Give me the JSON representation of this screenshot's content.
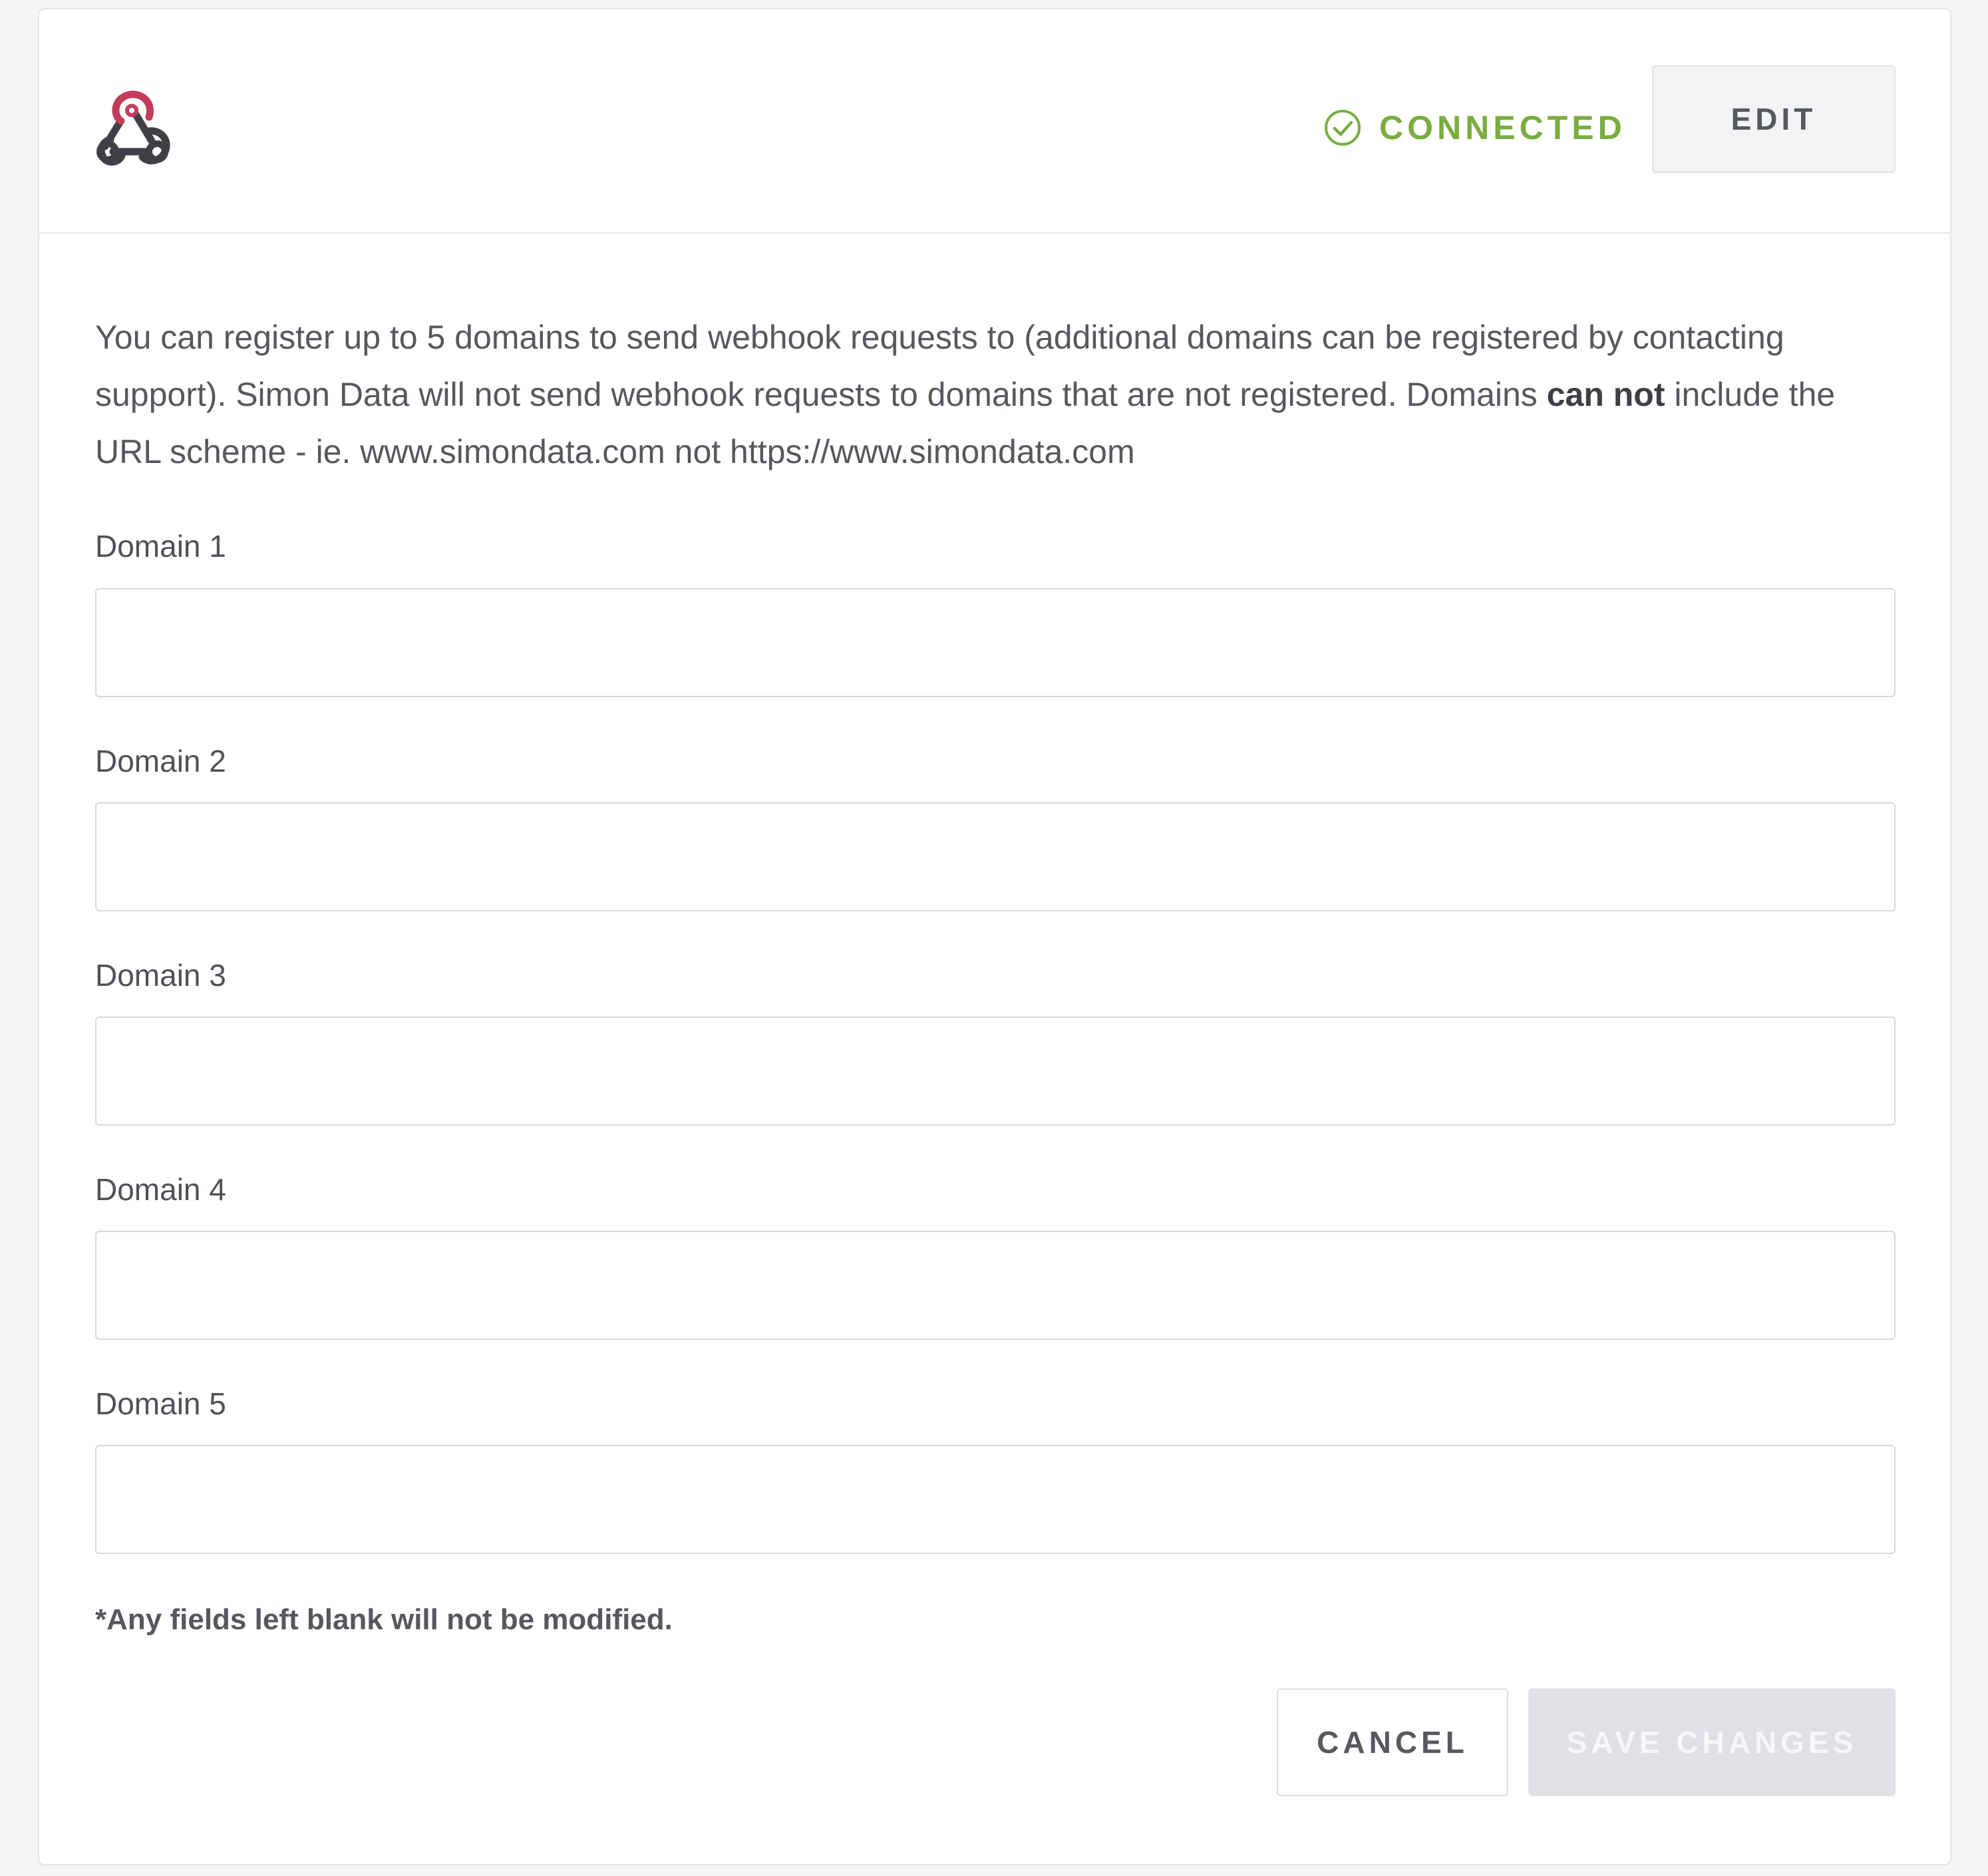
{
  "header": {
    "logo_icon": "webhook-icon",
    "status": {
      "icon": "check-circle-icon",
      "label": "CONNECTED",
      "color": "#79ad3f"
    },
    "edit_label": "EDIT"
  },
  "intro": {
    "part1": "You can register up to 5 domains to send webhook requests to (additional domains can be registered by contacting support). Simon Data will not send webhook requests to domains that are not registered. Domains ",
    "emphasis": "can not",
    "part2": " include the URL scheme - ie. www.simondata.com not https://www.simondata.com"
  },
  "fields": [
    {
      "label": "Domain 1",
      "value": "",
      "placeholder": ""
    },
    {
      "label": "Domain 2",
      "value": "",
      "placeholder": ""
    },
    {
      "label": "Domain 3",
      "value": "",
      "placeholder": ""
    },
    {
      "label": "Domain 4",
      "value": "",
      "placeholder": ""
    },
    {
      "label": "Domain 5",
      "value": "",
      "placeholder": ""
    }
  ],
  "note": "*Any fields left blank will not be modified.",
  "actions": {
    "cancel_label": "CANCEL",
    "save_label": "SAVE CHANGES"
  },
  "colors": {
    "webhook_accent": "#c33c5c",
    "webhook_dark": "#3f3f45"
  }
}
